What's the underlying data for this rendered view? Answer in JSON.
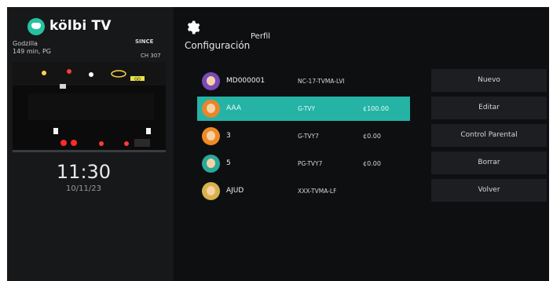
{
  "app": {
    "brand": "kölbi TV",
    "program_title": "Godzilla",
    "program_meta": "149 min, PG",
    "channel_logo": "SINCE",
    "channel_number": "CH 307",
    "preview_overlay": "GO"
  },
  "clock": {
    "time": "11:30",
    "date": "10/11/23"
  },
  "header": {
    "settings_icon": "gear-icon",
    "title": "Configuración",
    "subtitle": "Perfil"
  },
  "profiles": [
    {
      "name": "MD000001",
      "rating": "NC-17-TVMA-LVI",
      "credit": "",
      "selected": false,
      "avatar_color": "#7a4bb7"
    },
    {
      "name": "AAA",
      "rating": "G-TVY",
      "credit": "¢100.00",
      "selected": true,
      "avatar_color": "#e8862c"
    },
    {
      "name": "3",
      "rating": "G-TVY7",
      "credit": "¢0.00",
      "selected": false,
      "avatar_color": "#f08a24"
    },
    {
      "name": "5",
      "rating": "PG-TVY7",
      "credit": "¢0.00",
      "selected": false,
      "avatar_color": "#29a99a"
    },
    {
      "name": "AJUD",
      "rating": "XXX-TVMA-LF",
      "credit": "",
      "selected": false,
      "avatar_color": "#d7b24a"
    }
  ],
  "actions": [
    {
      "label": "Nuevo"
    },
    {
      "label": "Editar"
    },
    {
      "label": "Control Parental"
    },
    {
      "label": "Borrar"
    },
    {
      "label": "Volver"
    }
  ],
  "colors": {
    "accent": "#24b3a5",
    "background": "#0e0f11",
    "panel": "#17181a",
    "button": "#1d1e21"
  }
}
